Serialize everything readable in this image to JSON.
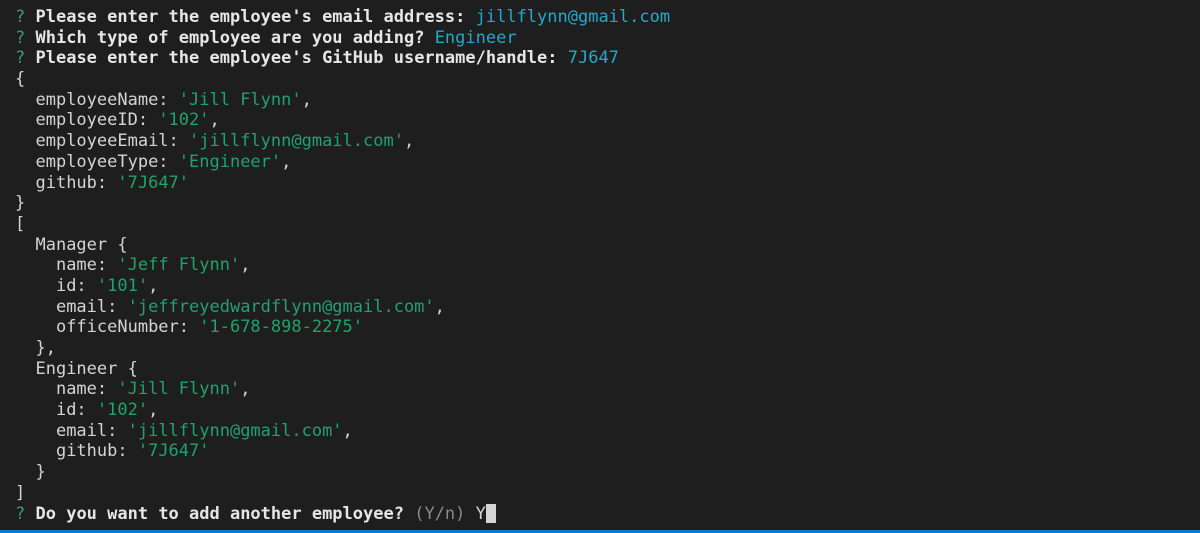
{
  "prompts": [
    {
      "q": "?",
      "text": "Please enter the employee's email address:",
      "answer": "jillflynn@gmail.com"
    },
    {
      "q": "?",
      "text": "Which type of employee are you adding?",
      "answer": "Engineer"
    },
    {
      "q": "?",
      "text": "Please enter the employee's GitHub username/handle:",
      "answer": "7J647"
    }
  ],
  "object": {
    "open": "{",
    "close": "}",
    "fields": [
      {
        "key": "employeeName: ",
        "value": "'Jill Flynn'",
        "sep": ","
      },
      {
        "key": "employeeID: ",
        "value": "'102'",
        "sep": ","
      },
      {
        "key": "employeeEmail: ",
        "value": "'jillflynn@gmail.com'",
        "sep": ","
      },
      {
        "key": "employeeType: ",
        "value": "'Engineer'",
        "sep": ","
      },
      {
        "key": "github: ",
        "value": "'7J647'",
        "sep": ""
      }
    ]
  },
  "array": {
    "open": "[",
    "close": "]",
    "items": [
      {
        "header": "Manager {",
        "close": "},",
        "fields": [
          {
            "key": "name: ",
            "value": "'Jeff Flynn'",
            "sep": ","
          },
          {
            "key": "id: ",
            "value": "'101'",
            "sep": ","
          },
          {
            "key": "email: ",
            "value": "'jeffreyedwardflynn@gmail.com'",
            "sep": ","
          },
          {
            "key": "officeNumber: ",
            "value": "'1-678-898-2275'",
            "sep": ""
          }
        ]
      },
      {
        "header": "Engineer {",
        "close": "}",
        "fields": [
          {
            "key": "name: ",
            "value": "'Jill Flynn'",
            "sep": ","
          },
          {
            "key": "id: ",
            "value": "'102'",
            "sep": ","
          },
          {
            "key": "email: ",
            "value": "'jillflynn@gmail.com'",
            "sep": ","
          },
          {
            "key": "github: ",
            "value": "'7J647'",
            "sep": ""
          }
        ]
      }
    ]
  },
  "final_prompt": {
    "q": "?",
    "text": "Do you want to add another employee?",
    "hint": "(Y/n)",
    "input": "Y"
  }
}
